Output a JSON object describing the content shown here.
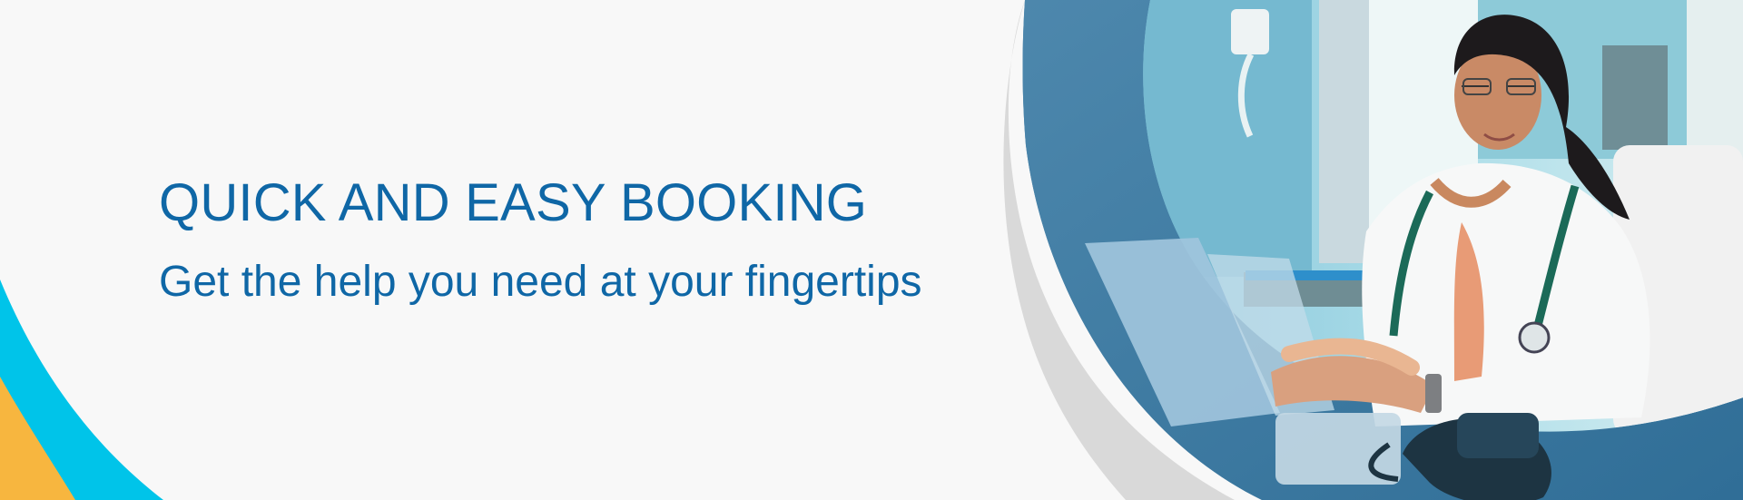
{
  "banner": {
    "headline": "QUICK AND EASY BOOKING",
    "subheadline": "Get the help you need at your fingertips"
  },
  "colors": {
    "headline": "#0f67a6",
    "background": "#f8f8f8",
    "accent_cyan": "#00c4e9",
    "accent_yellow": "#f7b63f",
    "photo_overlay": "#3c7aa2",
    "gray_wave": "#d9d9d9"
  },
  "images": {
    "hero": "doctor-at-desk-with-laptop-photo"
  }
}
